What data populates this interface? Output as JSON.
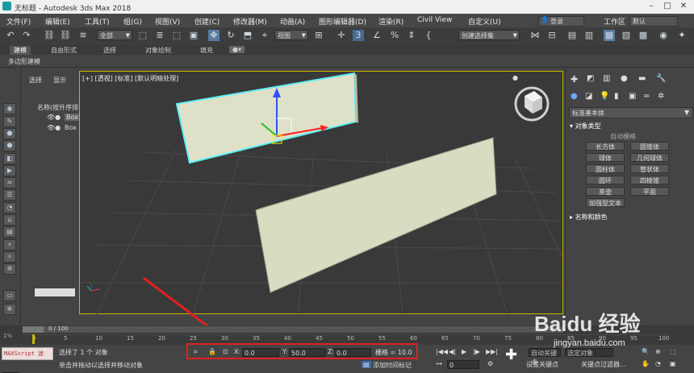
{
  "window": {
    "title": "无标题 - Autodesk 3ds Max 2018"
  },
  "menu": [
    "文件(F)",
    "编辑(E)",
    "工具(T)",
    "组(G)",
    "视图(V)",
    "创建(C)",
    "修改器(M)",
    "动画(A)",
    "图形编辑器(D)",
    "渲染(R)",
    "Civil View",
    "自定义(U)"
  ],
  "user": {
    "login": "登录",
    "workspace_label": "工作区",
    "workspace_value": "默认"
  },
  "toolbar": {
    "filter_value": "全部",
    "refcoord_value": "视图",
    "selection_set_placeholder": "创建选择集"
  },
  "ribbon": {
    "tabs": [
      "建模",
      "自由形式",
      "选择",
      "对象绘制",
      "填充"
    ],
    "subtitle": "多边形建模"
  },
  "scene_explorer": {
    "tabs": [
      "选择",
      "显示"
    ],
    "header": "名称(按升序排",
    "items": [
      "Box",
      "Box"
    ]
  },
  "viewport": {
    "label": "[+] [透视] [标准] [默认明暗处理]"
  },
  "command_panel": {
    "category": "标准基本体",
    "rollout_object_type": "对象类型",
    "autogrid": "自动栅格",
    "buttons": [
      "长方体",
      "圆锥体",
      "球体",
      "几何球体",
      "圆柱体",
      "管状体",
      "圆环",
      "四棱锥",
      "茶壶",
      "平面",
      "加强型文本"
    ],
    "rollout_name_color": "名称和颜色"
  },
  "timeline": {
    "frame": "0 / 100",
    "percent": "1%",
    "ticks": [
      "0",
      "5",
      "10",
      "15",
      "20",
      "25",
      "30",
      "35",
      "40",
      "45",
      "50",
      "55",
      "60",
      "65",
      "70",
      "75",
      "80",
      "85",
      "90",
      "95",
      "100"
    ]
  },
  "status": {
    "maxscript": "MAXScript 迷",
    "selected_text": "选择了 1 个 对象",
    "prompt_text": "单击并拖动以选择并移动对象",
    "x_label": "X:",
    "x_value": "0.0",
    "y_label": "Y:",
    "y_value": "50.0",
    "z_label": "Z:",
    "z_value": "0.0",
    "grid_text": "栅格 = 10.0",
    "add_time_tag": "添加时间标记",
    "set_key": "设置关键点",
    "key_filters": "关键点过滤器...",
    "frame_value": "0",
    "auto_key": "自动关键点",
    "selected_object": "选定对象"
  },
  "watermark": {
    "brand": "Baidu 经验",
    "url": "jingyan.baidu.com"
  },
  "colors": {
    "selection_cyan": "#5ef0f5",
    "viewport_border": "#c8b800",
    "annotation_red": "#e02020",
    "wall": "#d9dcc1"
  }
}
